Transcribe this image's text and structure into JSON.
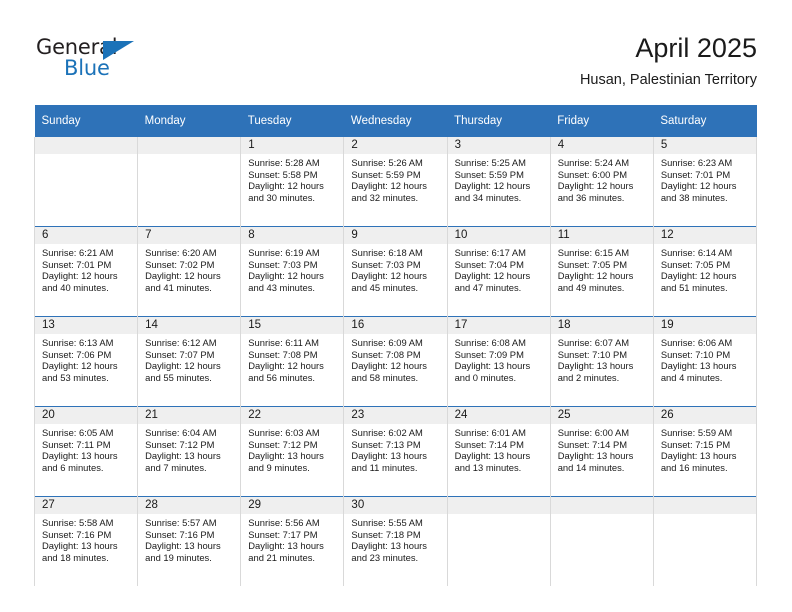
{
  "logo": {
    "word_top": "General",
    "word_bottom": "Blue",
    "triangle_icon": "triangle-icon",
    "color_dark": "#231f20",
    "color_blue": "#1b72b8"
  },
  "header": {
    "title": "April 2025",
    "subtitle": "Husan, Palestinian Territory"
  },
  "theme": {
    "header_blue": "#2e72b8",
    "daynum_band": "#efefef",
    "cell_border": "#d9d9d9",
    "text": "#1a1a1a"
  },
  "calendar": {
    "weekday_headers": [
      "Sunday",
      "Monday",
      "Tuesday",
      "Wednesday",
      "Thursday",
      "Friday",
      "Saturday"
    ],
    "labels": {
      "sunrise": "Sunrise:",
      "sunset": "Sunset:",
      "daylight": "Daylight:"
    },
    "weeks": [
      [
        {
          "day": "",
          "empty": true
        },
        {
          "day": "",
          "empty": true
        },
        {
          "day": "1",
          "sunrise": "Sunrise: 5:28 AM",
          "sunset": "Sunset: 5:58 PM",
          "daylight": "Daylight: 12 hours and 30 minutes."
        },
        {
          "day": "2",
          "sunrise": "Sunrise: 5:26 AM",
          "sunset": "Sunset: 5:59 PM",
          "daylight": "Daylight: 12 hours and 32 minutes."
        },
        {
          "day": "3",
          "sunrise": "Sunrise: 5:25 AM",
          "sunset": "Sunset: 5:59 PM",
          "daylight": "Daylight: 12 hours and 34 minutes."
        },
        {
          "day": "4",
          "sunrise": "Sunrise: 5:24 AM",
          "sunset": "Sunset: 6:00 PM",
          "daylight": "Daylight: 12 hours and 36 minutes."
        },
        {
          "day": "5",
          "sunrise": "Sunrise: 6:23 AM",
          "sunset": "Sunset: 7:01 PM",
          "daylight": "Daylight: 12 hours and 38 minutes."
        }
      ],
      [
        {
          "day": "6",
          "sunrise": "Sunrise: 6:21 AM",
          "sunset": "Sunset: 7:01 PM",
          "daylight": "Daylight: 12 hours and 40 minutes."
        },
        {
          "day": "7",
          "sunrise": "Sunrise: 6:20 AM",
          "sunset": "Sunset: 7:02 PM",
          "daylight": "Daylight: 12 hours and 41 minutes."
        },
        {
          "day": "8",
          "sunrise": "Sunrise: 6:19 AM",
          "sunset": "Sunset: 7:03 PM",
          "daylight": "Daylight: 12 hours and 43 minutes."
        },
        {
          "day": "9",
          "sunrise": "Sunrise: 6:18 AM",
          "sunset": "Sunset: 7:03 PM",
          "daylight": "Daylight: 12 hours and 45 minutes."
        },
        {
          "day": "10",
          "sunrise": "Sunrise: 6:17 AM",
          "sunset": "Sunset: 7:04 PM",
          "daylight": "Daylight: 12 hours and 47 minutes."
        },
        {
          "day": "11",
          "sunrise": "Sunrise: 6:15 AM",
          "sunset": "Sunset: 7:05 PM",
          "daylight": "Daylight: 12 hours and 49 minutes."
        },
        {
          "day": "12",
          "sunrise": "Sunrise: 6:14 AM",
          "sunset": "Sunset: 7:05 PM",
          "daylight": "Daylight: 12 hours and 51 minutes."
        }
      ],
      [
        {
          "day": "13",
          "sunrise": "Sunrise: 6:13 AM",
          "sunset": "Sunset: 7:06 PM",
          "daylight": "Daylight: 12 hours and 53 minutes."
        },
        {
          "day": "14",
          "sunrise": "Sunrise: 6:12 AM",
          "sunset": "Sunset: 7:07 PM",
          "daylight": "Daylight: 12 hours and 55 minutes."
        },
        {
          "day": "15",
          "sunrise": "Sunrise: 6:11 AM",
          "sunset": "Sunset: 7:08 PM",
          "daylight": "Daylight: 12 hours and 56 minutes."
        },
        {
          "day": "16",
          "sunrise": "Sunrise: 6:09 AM",
          "sunset": "Sunset: 7:08 PM",
          "daylight": "Daylight: 12 hours and 58 minutes."
        },
        {
          "day": "17",
          "sunrise": "Sunrise: 6:08 AM",
          "sunset": "Sunset: 7:09 PM",
          "daylight": "Daylight: 13 hours and 0 minutes."
        },
        {
          "day": "18",
          "sunrise": "Sunrise: 6:07 AM",
          "sunset": "Sunset: 7:10 PM",
          "daylight": "Daylight: 13 hours and 2 minutes."
        },
        {
          "day": "19",
          "sunrise": "Sunrise: 6:06 AM",
          "sunset": "Sunset: 7:10 PM",
          "daylight": "Daylight: 13 hours and 4 minutes."
        }
      ],
      [
        {
          "day": "20",
          "sunrise": "Sunrise: 6:05 AM",
          "sunset": "Sunset: 7:11 PM",
          "daylight": "Daylight: 13 hours and 6 minutes."
        },
        {
          "day": "21",
          "sunrise": "Sunrise: 6:04 AM",
          "sunset": "Sunset: 7:12 PM",
          "daylight": "Daylight: 13 hours and 7 minutes."
        },
        {
          "day": "22",
          "sunrise": "Sunrise: 6:03 AM",
          "sunset": "Sunset: 7:12 PM",
          "daylight": "Daylight: 13 hours and 9 minutes."
        },
        {
          "day": "23",
          "sunrise": "Sunrise: 6:02 AM",
          "sunset": "Sunset: 7:13 PM",
          "daylight": "Daylight: 13 hours and 11 minutes."
        },
        {
          "day": "24",
          "sunrise": "Sunrise: 6:01 AM",
          "sunset": "Sunset: 7:14 PM",
          "daylight": "Daylight: 13 hours and 13 minutes."
        },
        {
          "day": "25",
          "sunrise": "Sunrise: 6:00 AM",
          "sunset": "Sunset: 7:14 PM",
          "daylight": "Daylight: 13 hours and 14 minutes."
        },
        {
          "day": "26",
          "sunrise": "Sunrise: 5:59 AM",
          "sunset": "Sunset: 7:15 PM",
          "daylight": "Daylight: 13 hours and 16 minutes."
        }
      ],
      [
        {
          "day": "27",
          "sunrise": "Sunrise: 5:58 AM",
          "sunset": "Sunset: 7:16 PM",
          "daylight": "Daylight: 13 hours and 18 minutes."
        },
        {
          "day": "28",
          "sunrise": "Sunrise: 5:57 AM",
          "sunset": "Sunset: 7:16 PM",
          "daylight": "Daylight: 13 hours and 19 minutes."
        },
        {
          "day": "29",
          "sunrise": "Sunrise: 5:56 AM",
          "sunset": "Sunset: 7:17 PM",
          "daylight": "Daylight: 13 hours and 21 minutes."
        },
        {
          "day": "30",
          "sunrise": "Sunrise: 5:55 AM",
          "sunset": "Sunset: 7:18 PM",
          "daylight": "Daylight: 13 hours and 23 minutes."
        },
        {
          "day": "",
          "empty": true
        },
        {
          "day": "",
          "empty": true
        },
        {
          "day": "",
          "empty": true
        }
      ]
    ]
  }
}
